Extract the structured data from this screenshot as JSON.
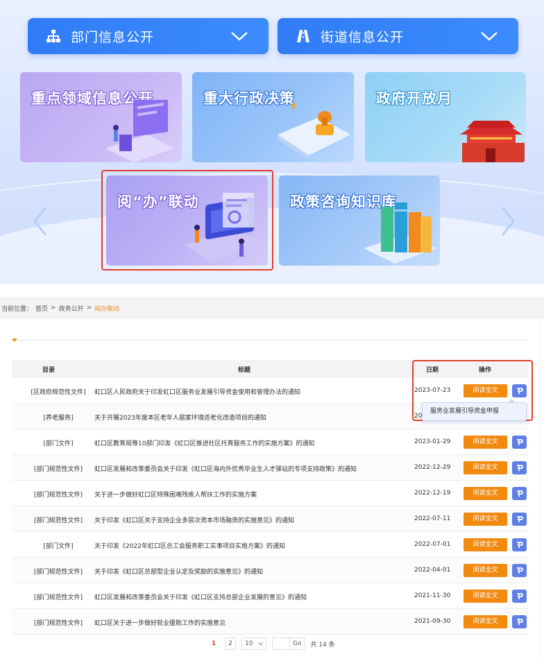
{
  "banner": {
    "dropdowns": [
      {
        "label": "部门信息公开",
        "icon": "org-chart-icon"
      },
      {
        "label": "街道信息公开",
        "icon": "road-icon"
      }
    ],
    "cards": [
      {
        "title": "重点领域信息公开"
      },
      {
        "title": "重大行政决策"
      },
      {
        "title": "政府开放月"
      },
      {
        "title": "阅“办”联动"
      },
      {
        "title": "政策咨询知识库"
      }
    ]
  },
  "breadcrumb": {
    "prefix": "当前位置：",
    "items": [
      "首页",
      ">",
      "政务公开",
      ">"
    ],
    "current": "阅办联动"
  },
  "table": {
    "headers": {
      "category": "目录",
      "title": "标题",
      "date": "日期",
      "action": "操作"
    },
    "read_label": "阅读全文",
    "rows": [
      {
        "category": "[区政府规范性文件]",
        "title": "虹口区人民政府关于印发虹口区服务业发展引导资金使用和管理办法的通知",
        "date": "2023-07-23"
      },
      {
        "category": "[养老服务]",
        "title": "关于开展2023年度本区老年人居家环境适老化改造项目的通知",
        "date": "20"
      },
      {
        "category": "[部门文件]",
        "title": "虹口区教育局等10部门印发《虹口区推进社区托育服务工作的实施方案》的通知",
        "date": "2023-01-29"
      },
      {
        "category": "[部门规范性文件]",
        "title": "虹口区发展和改革委员会关于印发《虹口区海内外优秀毕业生人才驿站的专项支持政策》的通知",
        "date": "2022-12-29"
      },
      {
        "category": "[部门规范性文件]",
        "title": "关于进一步做好虹口区特殊困难残疾人帮扶工作的实施方案",
        "date": "2022-12-19"
      },
      {
        "category": "[部门规范性文件]",
        "title": "关于印发《虹口区关于支持企业多层次资本市场融资的实施意见》的通知",
        "date": "2022-07-11"
      },
      {
        "category": "[部门文件]",
        "title": "关于印发《2022年虹口区总工会服务职工实事项目实施方案》的通知",
        "date": "2022-07-01"
      },
      {
        "category": "[部门规范性文件]",
        "title": "关于印发《虹口区总部型企业认定及奖励的实施意见》的通知",
        "date": "2022-04-01"
      },
      {
        "category": "[部门规范性文件]",
        "title": "虹口区发展和改革委员会关于印发《虹口区支持总部企业发展的意见》的通知",
        "date": "2021-11-30"
      },
      {
        "category": "[部门规范性文件]",
        "title": "虹口区关于进一步做好就业援助工作的实施意见",
        "date": "2021-09-30"
      }
    ],
    "tooltip": "服务业发展引导资金申报"
  },
  "pager": {
    "pages": [
      "1",
      "2"
    ],
    "page_size": "10",
    "go_label": "Go",
    "total": "共 14 条"
  },
  "colors": {
    "accent_blue": "#2f7cf6",
    "read_button": "#f28a0f",
    "highlight_red": "#e23b2c",
    "breadcrumb_current": "#f08a1c"
  }
}
